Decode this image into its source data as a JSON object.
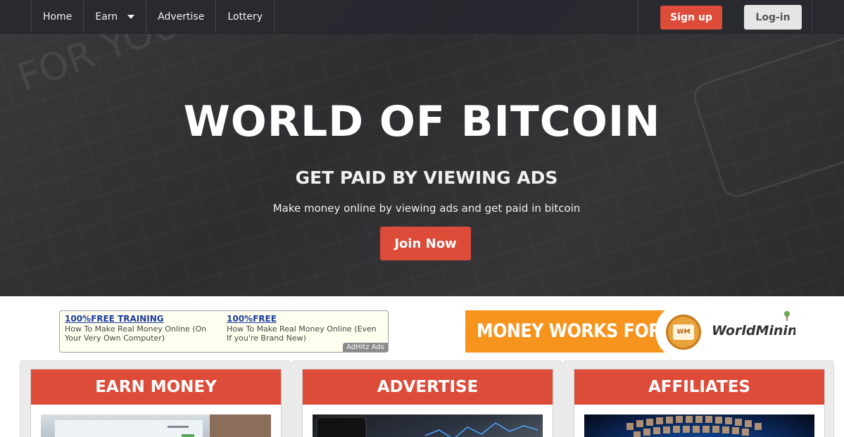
{
  "nav": {
    "items": [
      {
        "label": "Home"
      },
      {
        "label": "Earn"
      },
      {
        "label": "Advertise"
      },
      {
        "label": "Lottery"
      }
    ],
    "signup_label": "Sign up",
    "login_label": "Log-in"
  },
  "hero": {
    "title": "WORLD OF BITCOIN",
    "subtitle": "GET PAID BY VIEWING ADS",
    "description": "Make money online by viewing ads and get paid in bitcoin",
    "join_label": "Join Now",
    "deco_text": "FOR YOU"
  },
  "ads": {
    "text_ad": {
      "items": [
        {
          "title": "100%FREE TRAINING",
          "body": "How To Make Real Money Online (On Your Very Own Computer)"
        },
        {
          "title": "100%FREE",
          "body": "How To Make Real Money Online (Even If you're Brand New)"
        }
      ],
      "tag": "AdHitz Ads"
    },
    "banner": {
      "slogan": "MONEY WORKS FOR US",
      "seal": "WM",
      "brand": "WorldMining"
    }
  },
  "cards": [
    {
      "title": "EARN MONEY"
    },
    {
      "title": "ADVERTISE"
    },
    {
      "title": "AFFILIATES"
    }
  ],
  "colors": {
    "accent": "#dd4b39",
    "nav_bg": "#28282f",
    "banner_orange": "#f7941d",
    "ad_link": "#1a3b9c"
  }
}
